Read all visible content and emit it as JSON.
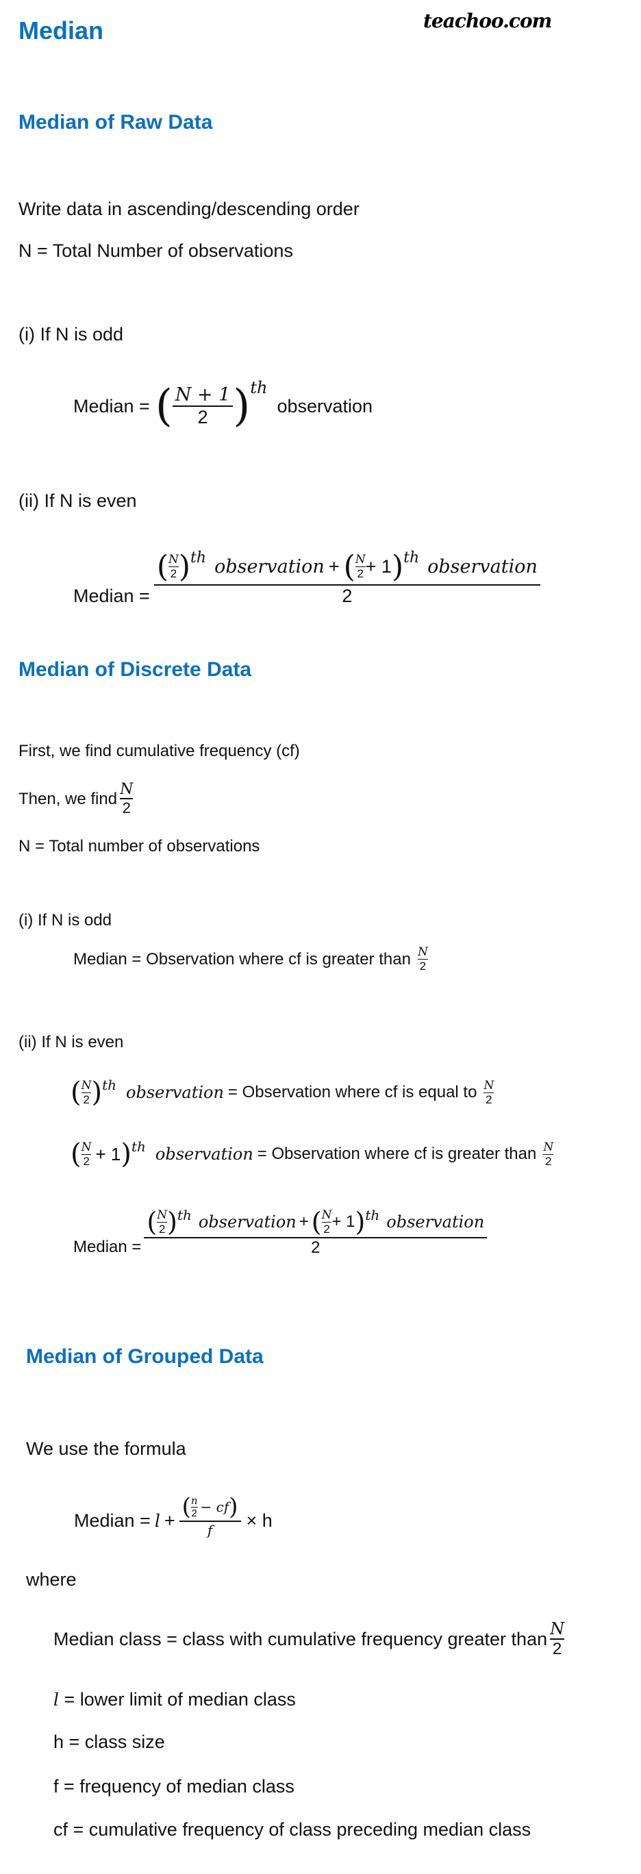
{
  "logo": "teachoo.com",
  "title": "Median",
  "colors": {
    "heading": "#0a70c0",
    "text": "#111111"
  },
  "raw": {
    "heading": "Median of Raw Data",
    "line1": "Write data in ascending/descending order",
    "line2": "N = Total Number of observations",
    "odd_label": "(i) If N is odd",
    "odd_formula": {
      "lhs": "Median =",
      "num": "N + 1",
      "den": "2",
      "sup": "th",
      "tail": "observation"
    },
    "even_label": "(ii) If N is even",
    "even_formula": {
      "lhs": "Median =",
      "n": "N",
      "two": "2",
      "sup": "th",
      "obs": "observation",
      "plus": "+",
      "plus_one": "+ 1",
      "den": "2"
    }
  },
  "discrete": {
    "heading": "Median of Discrete Data",
    "line1": "First, we find cumulative frequency (cf)",
    "line2": "Then, we find",
    "line3": "N = Total number of observations",
    "odd_label": "(i) If N is odd",
    "odd_formula": "Median = Observation where cf is greater than",
    "even_label": "(ii) If N is even",
    "even_row1_rhs": "= Observation where cf is equal to",
    "even_row2_rhs": "= Observation where cf is greater than",
    "n": "N",
    "two": "2",
    "sup": "th",
    "obs": "observation",
    "plus_one": "+ 1",
    "plus": "+",
    "median_lhs": "Median =",
    "median_den": "2"
  },
  "grouped": {
    "heading": "Median of Grouped Data",
    "intro": "We use the formula",
    "formula": {
      "lhs": "Median =",
      "l": "l",
      "plus": "+",
      "n": "n",
      "two": "2",
      "minus_cf": "− cf",
      "f": "f",
      "times_h": "× h"
    },
    "where": "where",
    "defs": [
      "Median class = class with cumulative frequency greater than",
      "= lower limit of median class",
      "h = class size",
      "f = frequency of median class",
      "cf =  cumulative frequency of class preceding median class"
    ],
    "l_symbol": "l"
  }
}
